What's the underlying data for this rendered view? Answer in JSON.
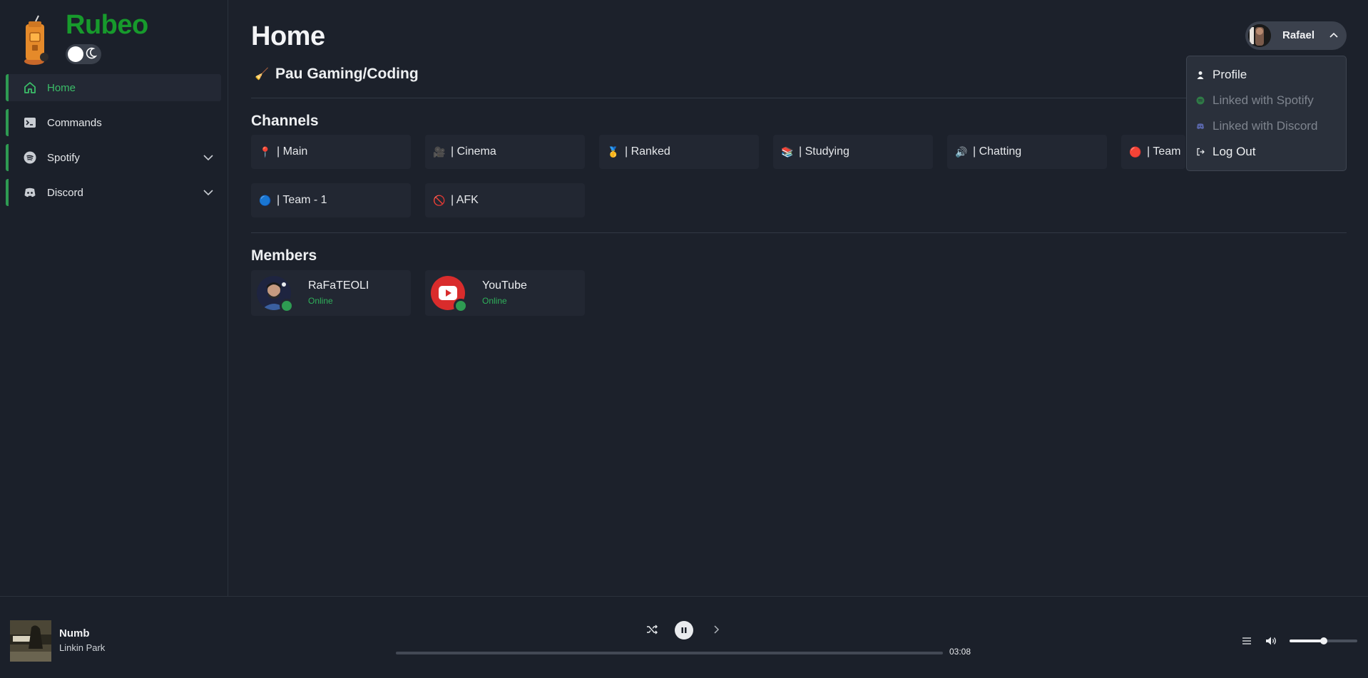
{
  "app": {
    "brand": "Rubeo",
    "brand_color": "#179a2c",
    "accent_color": "#2e9b52"
  },
  "theme_toggle": {
    "icon": "moon-icon",
    "state": "light"
  },
  "sidebar": {
    "items": [
      {
        "label": "Home",
        "icon": "home-icon",
        "active": true
      },
      {
        "label": "Commands",
        "icon": "terminal-icon"
      },
      {
        "label": "Spotify",
        "icon": "spotify-icon",
        "expandable": true
      },
      {
        "label": "Discord",
        "icon": "discord-icon",
        "expandable": true
      }
    ]
  },
  "header": {
    "title": "Home",
    "server_emoji": "🧹",
    "server_name": "Pau Gaming/Coding"
  },
  "user_menu": {
    "name": "Rafael",
    "items": [
      {
        "label": "Profile",
        "icon": "user-icon",
        "enabled": true
      },
      {
        "label": "Linked with Spotify",
        "icon": "spotify-icon",
        "enabled": false
      },
      {
        "label": "Linked with Discord",
        "icon": "discord-icon",
        "enabled": false
      },
      {
        "label": "Log Out",
        "icon": "logout-icon",
        "enabled": true
      }
    ]
  },
  "channels": {
    "title": "Channels",
    "items": [
      {
        "emoji": "📍",
        "label": "| Main"
      },
      {
        "emoji": "🎥",
        "label": "| Cinema"
      },
      {
        "emoji": "🥇",
        "label": "| Ranked"
      },
      {
        "emoji": "📚",
        "label": "| Studying"
      },
      {
        "emoji": "🔊",
        "label": "| Chatting"
      },
      {
        "emoji": "🔴",
        "label": "| Team"
      },
      {
        "emoji": "🔵",
        "label": "| Team - 1"
      },
      {
        "emoji": "🚫",
        "label": "| AFK"
      }
    ]
  },
  "members": {
    "title": "Members",
    "items": [
      {
        "name": "RaFaTEOLI",
        "status": "Online",
        "avatar": "user-avatar"
      },
      {
        "name": "YouTube",
        "status": "Online",
        "avatar": "youtube-icon"
      }
    ]
  },
  "player": {
    "track": "Numb",
    "artist": "Linkin Park",
    "time": "03:08",
    "progress": 0.0,
    "volume": 0.5,
    "state": "playing"
  }
}
